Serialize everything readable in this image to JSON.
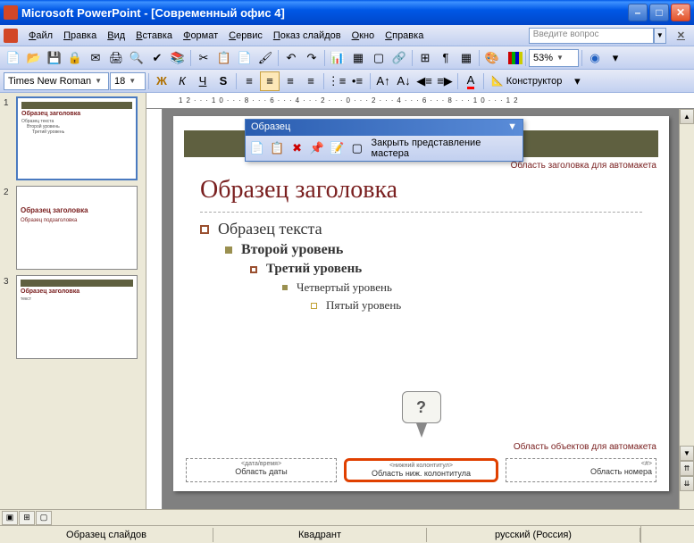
{
  "window": {
    "title": "Microsoft PowerPoint - [Современный офис 4]"
  },
  "menu": {
    "file": "Файл",
    "edit": "Правка",
    "view": "Вид",
    "insert": "Вставка",
    "format": "Формат",
    "tools": "Сервис",
    "slideshow": "Показ слайдов",
    "window": "Окно",
    "help": "Справка",
    "help_placeholder": "Введите вопрос"
  },
  "toolbar": {
    "zoom": "53%"
  },
  "format_bar": {
    "font": "Times New Roman",
    "size": "18",
    "konstruktor": "Конструктор"
  },
  "ruler": "12···10···8···6···4···2···0···2···4···6···8···10···12",
  "floating": {
    "title": "Образец",
    "close_master": "Закрыть представление мастера"
  },
  "thumbs": {
    "n1": "1",
    "n2": "2",
    "n3": "3",
    "t1_title": "Образец заголовка",
    "t1_body": "Образец текста",
    "t2_title": "Образец заголовка",
    "t2_body": "Образец подзаголовка",
    "t3_title": "Образец заголовка",
    "t3_body": "текст"
  },
  "slide": {
    "auto_title": "Область заголовка для автомакета",
    "title": "Образец заголовка",
    "lvl1": "Образец текста",
    "lvl2": "Второй уровень",
    "lvl3": "Третий уровень",
    "lvl4": "Четвертый уровень",
    "lvl5": "Пятый уровень",
    "auto_obj": "Область объектов для автомакета",
    "date_label": "<дата/время>",
    "date_text": "Область даты",
    "footer_label": "<нижний колонтитул>",
    "footer_text": "Область ниж. колонтитула",
    "num_label": "<#>",
    "num_text": "Область номера",
    "callout": "?"
  },
  "status": {
    "left": "Образец слайдов",
    "center": "Квадрант",
    "lang": "русский (Россия)"
  }
}
